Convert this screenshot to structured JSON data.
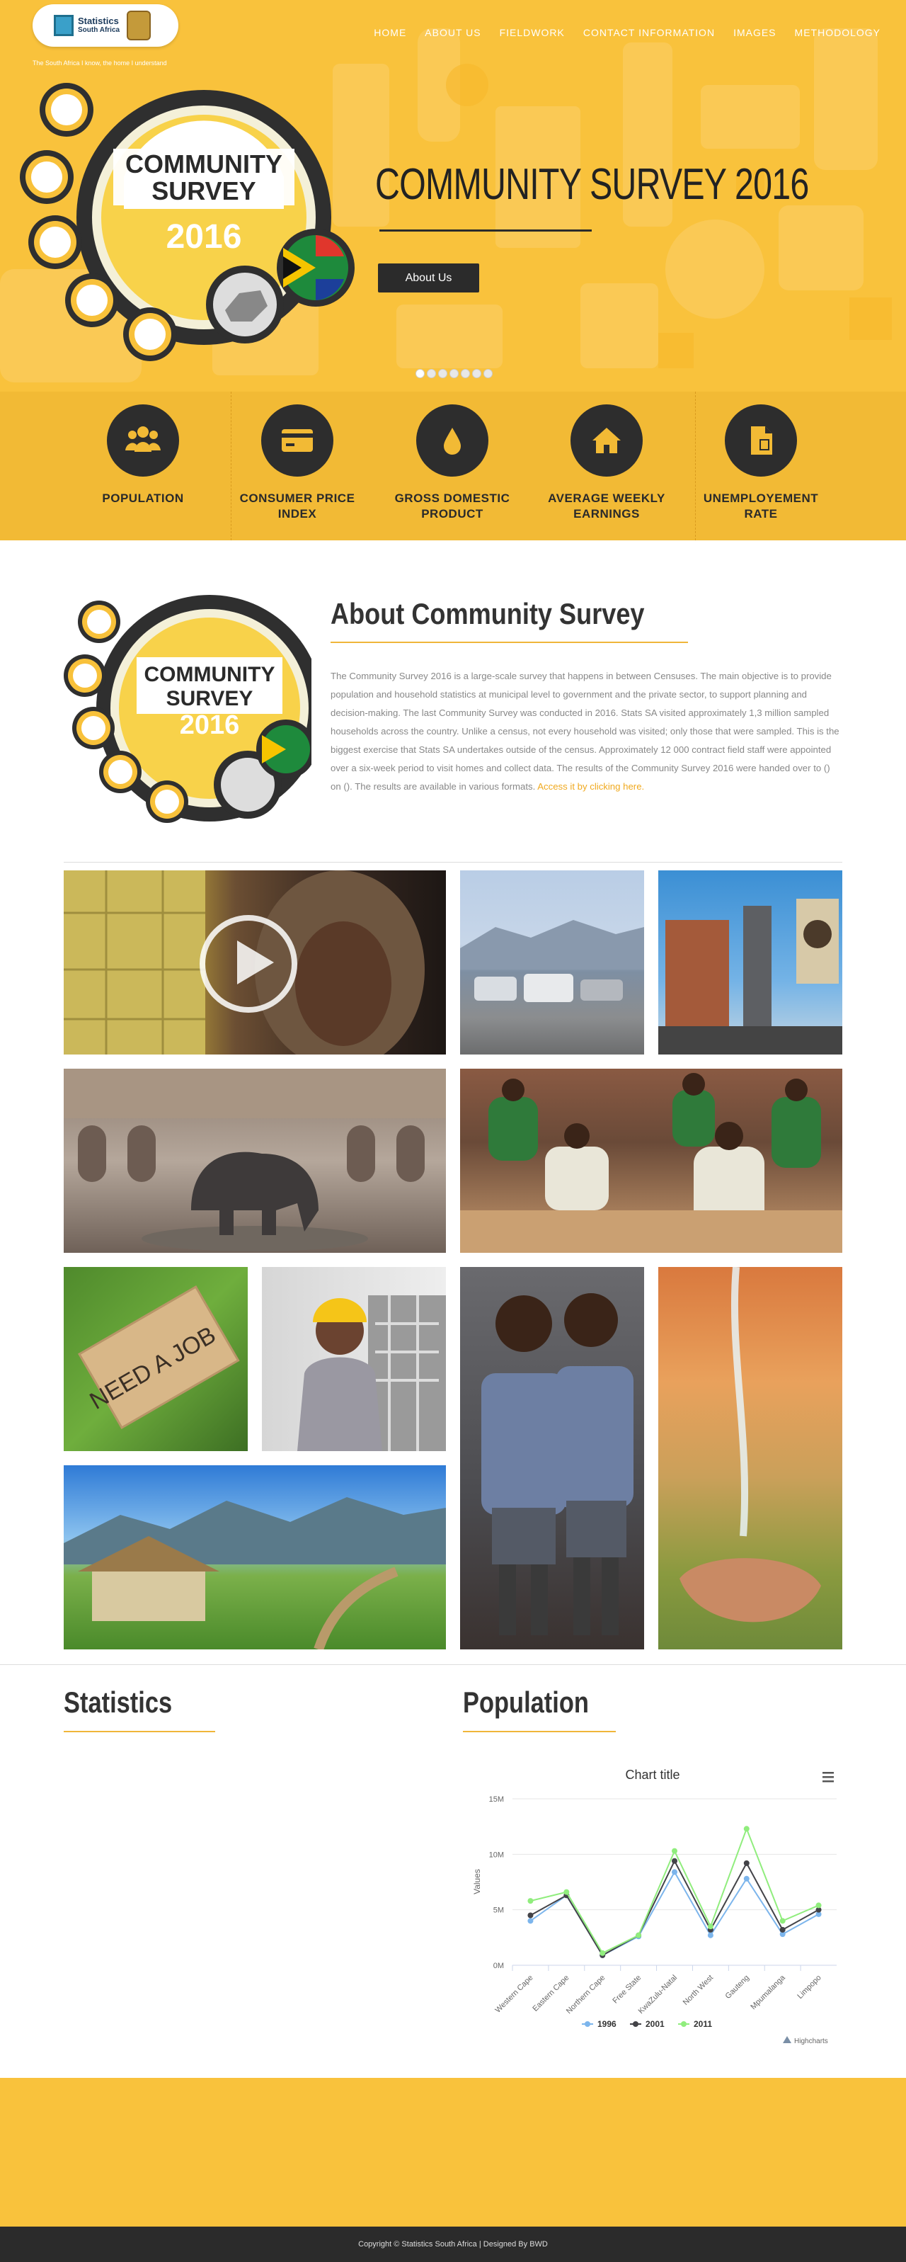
{
  "header": {
    "logo_line1": "Statistics",
    "logo_line2": "South Africa",
    "breadcrumb": "The South Africa I know, the home I understand",
    "nav": [
      "HOME",
      "ABOUT US",
      "FIELDWORK",
      "CONTACT INFORMATION",
      "IMAGES",
      "METHODOLOGY"
    ]
  },
  "hero": {
    "badge_line1": "COMMUNITY",
    "badge_line2": "SURVEY",
    "badge_year": "2016",
    "title": "COMMUNITY SURVEY 2016",
    "button": "About Us",
    "slide_count": 7,
    "active_slide": 1
  },
  "categories": [
    {
      "label1": "POPULATION",
      "label2": "",
      "icon": "people-icon"
    },
    {
      "label1": "CONSUMER PRICE",
      "label2": "INDEX",
      "icon": "card-icon"
    },
    {
      "label1": "GROSS DOMESTIC",
      "label2": "PRODUCT",
      "icon": "drop-icon"
    },
    {
      "label1": "AVERAGE WEEKLY",
      "label2": "EARNINGS",
      "icon": "home-icon"
    },
    {
      "label1": "UNEMPLOYEMENT",
      "label2": "RATE",
      "icon": "document-icon"
    }
  ],
  "about": {
    "title": "About Community Survey",
    "text": "The Community Survey 2016 is a large-scale survey that happens in between Censuses. The main objective is to provide population and household statistics at municipal level to government and the private sector, to support planning and decision-making. The last Community Survey was conducted in 2016. Stats SA visited approximately 1,3 million sampled households across the country. Unlike a census, not every household was visited; only those that were sampled. This is the biggest exercise that Stats SA undertakes outside of the census. Approximately 12 000 contract field staff were appointed over a six-week period to visit homes and collect data. The results of the Community Survey 2016 were handed over to () on (). The results are available in various formats.",
    "link": "Access it by clicking here."
  },
  "gallery_sign_text": "NEED A JOB",
  "stats": {
    "title": "Statistics"
  },
  "population": {
    "title": "Population",
    "menu_icon": "hamburger-icon",
    "credit": "Highcharts"
  },
  "chart_data": {
    "type": "line",
    "title": "Chart title",
    "ylabel": "Values",
    "xlabel": "",
    "categories": [
      "Western Cape",
      "Eastern Cape",
      "Northern Cape",
      "Free State",
      "KwaZulu-Natal",
      "North West",
      "Gauteng",
      "Mpumalanga",
      "Limpopo"
    ],
    "y_ticks": [
      "0M",
      "5M",
      "10M",
      "15M"
    ],
    "ylim": [
      0,
      15
    ],
    "grid": true,
    "legend_position": "bottom",
    "series": [
      {
        "name": "1996",
        "color": "#7cb5ec",
        "values": [
          4.0,
          6.3,
          0.9,
          2.6,
          8.4,
          2.7,
          7.8,
          2.8,
          4.6
        ]
      },
      {
        "name": "2001",
        "color": "#434348",
        "values": [
          4.5,
          6.3,
          0.9,
          2.7,
          9.4,
          3.2,
          9.2,
          3.2,
          5.0
        ]
      },
      {
        "name": "2011",
        "color": "#90ed7d",
        "values": [
          5.8,
          6.6,
          1.1,
          2.7,
          10.3,
          3.5,
          12.3,
          4.0,
          5.4
        ]
      }
    ]
  },
  "footer": {
    "text": "Copyright © Statistics South Africa | Designed By BWD"
  },
  "colors": {
    "brand_yellow": "#f9c23c",
    "dark": "#2b2b2b",
    "accent": "#f0b63a"
  }
}
